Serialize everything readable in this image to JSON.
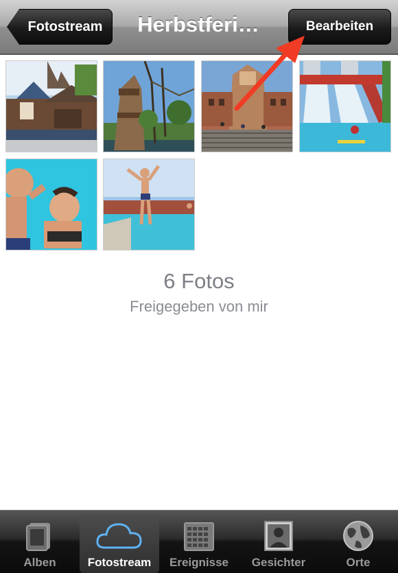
{
  "navbar": {
    "back_label": "Fotostream",
    "title": "Herbstferi…",
    "edit_label": "Bearbeiten"
  },
  "album": {
    "photo_count": "6 Fotos",
    "shared_by": "Freigegeben von mir",
    "photos": [
      {
        "name": "photo-temple-building"
      },
      {
        "name": "photo-treehouse-tower"
      },
      {
        "name": "photo-aztec-pyramid"
      },
      {
        "name": "photo-water-slides"
      },
      {
        "name": "photo-kids-underwater"
      },
      {
        "name": "photo-boy-jumping-pool"
      }
    ]
  },
  "tabbar": {
    "tabs": [
      {
        "label": "Alben",
        "icon": "albums-icon",
        "active": false
      },
      {
        "label": "Fotostream",
        "icon": "cloud-icon",
        "active": true
      },
      {
        "label": "Ereignisse",
        "icon": "calendar-grid-icon",
        "active": false
      },
      {
        "label": "Gesichter",
        "icon": "face-portrait-icon",
        "active": false
      },
      {
        "label": "Orte",
        "icon": "globe-icon",
        "active": false
      }
    ]
  },
  "colors": {
    "annotation_arrow": "#f03c24",
    "cloud_blue": "#5fb2f2",
    "count_text": "#7d7f86"
  }
}
